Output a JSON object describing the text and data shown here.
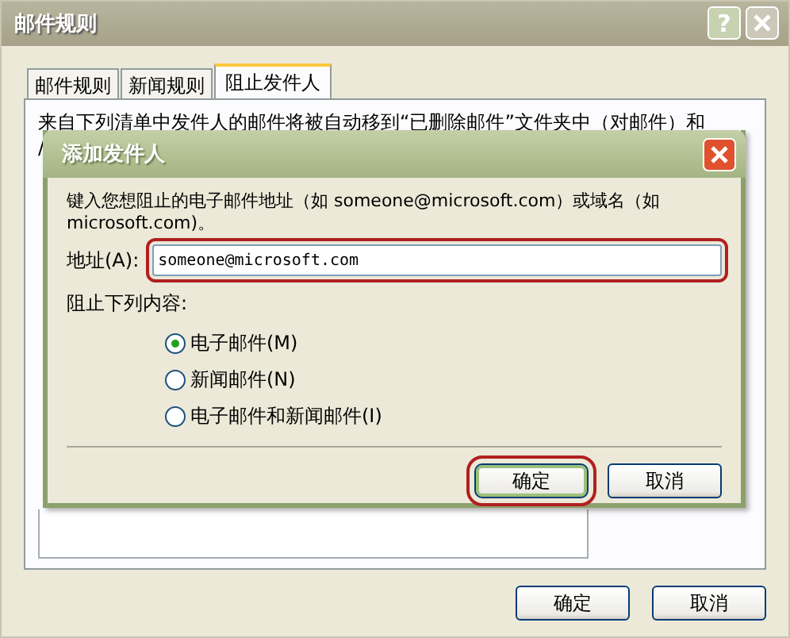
{
  "window": {
    "title": "邮件规则",
    "help_button": "?"
  },
  "tabs": [
    {
      "label": "邮件规则",
      "selected": false
    },
    {
      "label": "新闻规则",
      "selected": false
    },
    {
      "label": "阻止发件人",
      "selected": true
    }
  ],
  "panel": {
    "description": "来自下列清单中发件人的邮件将被自动移到“已删除邮件”文件夹中（对邮件）和",
    "description_line_2": "/"
  },
  "dialog": {
    "title": "添加发件人",
    "instruction": "键入您想阻止的电子邮件地址（如 someone@microsoft.com）或域名（如 microsoft.com)。",
    "address_label": "地址(A):",
    "address_value": "someone@microsoft.com",
    "block_label": "阻止下列内容:",
    "options": [
      {
        "label": "电子邮件(M)",
        "selected": true
      },
      {
        "label": "新闻邮件(N)",
        "selected": false
      },
      {
        "label": "电子邮件和新闻邮件(I)",
        "selected": false
      }
    ],
    "buttons": [
      {
        "label": "确定",
        "highlighted": true
      },
      {
        "label": "取消",
        "highlighted": false
      }
    ]
  },
  "buttons": [
    "确定",
    "取消"
  ]
}
